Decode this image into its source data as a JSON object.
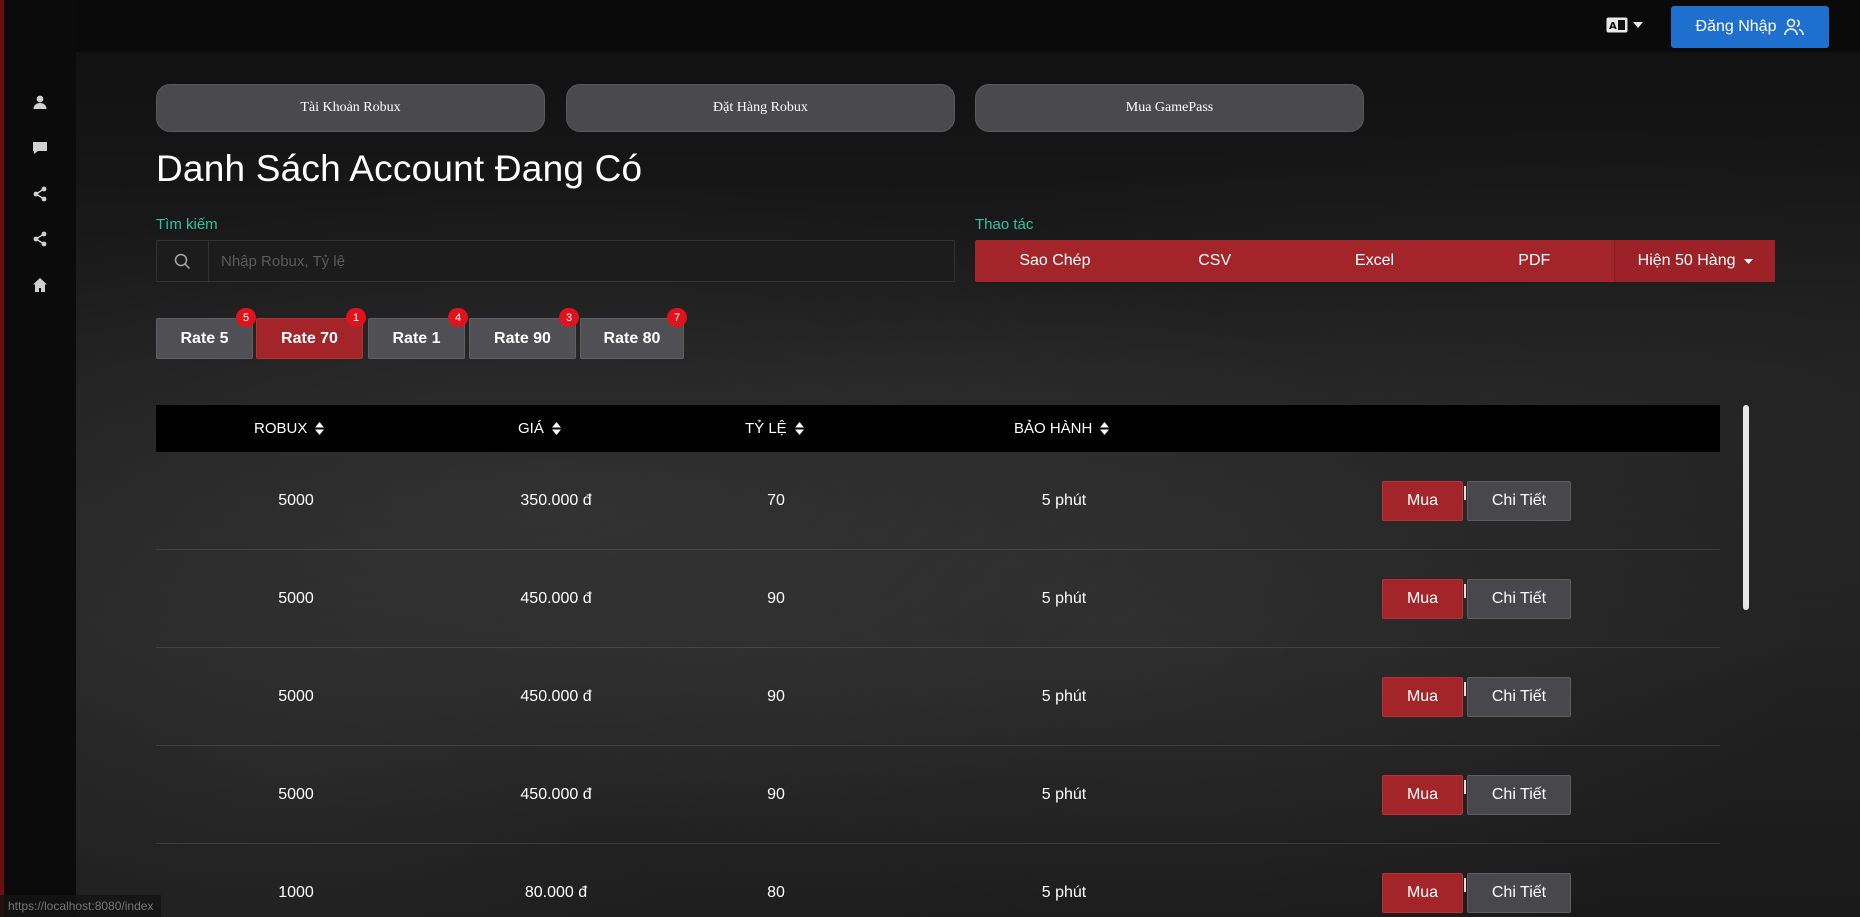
{
  "topbar": {
    "login_label": "Đăng Nhập"
  },
  "sidebar": {
    "items": [
      {
        "icon": "user-icon"
      },
      {
        "icon": "chat-icon"
      },
      {
        "icon": "share-icon"
      },
      {
        "icon": "share-icon"
      },
      {
        "icon": "home-icon"
      }
    ]
  },
  "nav": {
    "tabs": [
      "Tài Khoản Robux",
      "Đặt Hàng Robux",
      "Mua GamePass"
    ]
  },
  "page": {
    "title": "Danh Sách Account Đang Có"
  },
  "search": {
    "label": "Tìm kiếm",
    "placeholder": "Nhập Robux, Tỷ lệ"
  },
  "actions": {
    "label": "Thao tác",
    "copy": "Sao Chép",
    "csv": "CSV",
    "excel": "Excel",
    "pdf": "PDF",
    "show_rows": "Hiện 50 Hàng"
  },
  "filters": [
    {
      "label": "Rate 5",
      "count": "5",
      "active": false
    },
    {
      "label": "Rate 70",
      "count": "1",
      "active": true
    },
    {
      "label": "Rate 1",
      "count": "4",
      "active": false
    },
    {
      "label": "Rate 90",
      "count": "3",
      "active": false
    },
    {
      "label": "Rate 80",
      "count": "7",
      "active": false
    }
  ],
  "table": {
    "headers": [
      "ROBUX",
      "GIÁ",
      "TỶ LỆ",
      "BẢO HÀNH"
    ],
    "buy_label": "Mua",
    "detail_label": "Chi Tiết",
    "rows": [
      {
        "robux": "5000",
        "price": "350.000 đ",
        "rate": "70",
        "warranty": "5 phút"
      },
      {
        "robux": "5000",
        "price": "450.000 đ",
        "rate": "90",
        "warranty": "5 phút"
      },
      {
        "robux": "5000",
        "price": "450.000 đ",
        "rate": "90",
        "warranty": "5 phút"
      },
      {
        "robux": "5000",
        "price": "450.000 đ",
        "rate": "90",
        "warranty": "5 phút"
      },
      {
        "robux": "1000",
        "price": "80.000 đ",
        "rate": "80",
        "warranty": "5 phút"
      }
    ]
  },
  "statusbar": {
    "url": "https://localhost:8080/index"
  },
  "colors": {
    "accent_red": "#a3252a",
    "login_blue": "#1f6fcf",
    "label_teal": "#2fc1a4",
    "badge_red": "#e0121b"
  }
}
